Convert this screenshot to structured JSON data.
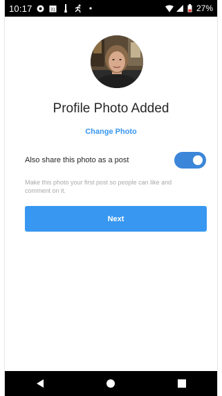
{
  "status_bar": {
    "time": "10:17",
    "calendar_day": "31",
    "battery_percent": "27%",
    "icons": [
      "circle-notification-icon",
      "calendar-icon",
      "tool-icon",
      "running-icon",
      "dot-icon",
      "wifi-icon",
      "signal-icon",
      "battery-low-icon"
    ]
  },
  "profile": {
    "title": "Profile Photo Added",
    "change_photo_label": "Change Photo"
  },
  "share": {
    "label": "Also share this photo as a post",
    "enabled": true,
    "hint": "Make this photo your first post so people can like and comment on it."
  },
  "actions": {
    "next_label": "Next"
  },
  "nav_bar": {
    "icons": [
      "back-icon",
      "home-icon",
      "recents-icon"
    ]
  },
  "colors": {
    "accent": "#3897f0",
    "toggle": "#3b86d9",
    "text": "#262626",
    "hint": "#a8a8a8"
  }
}
